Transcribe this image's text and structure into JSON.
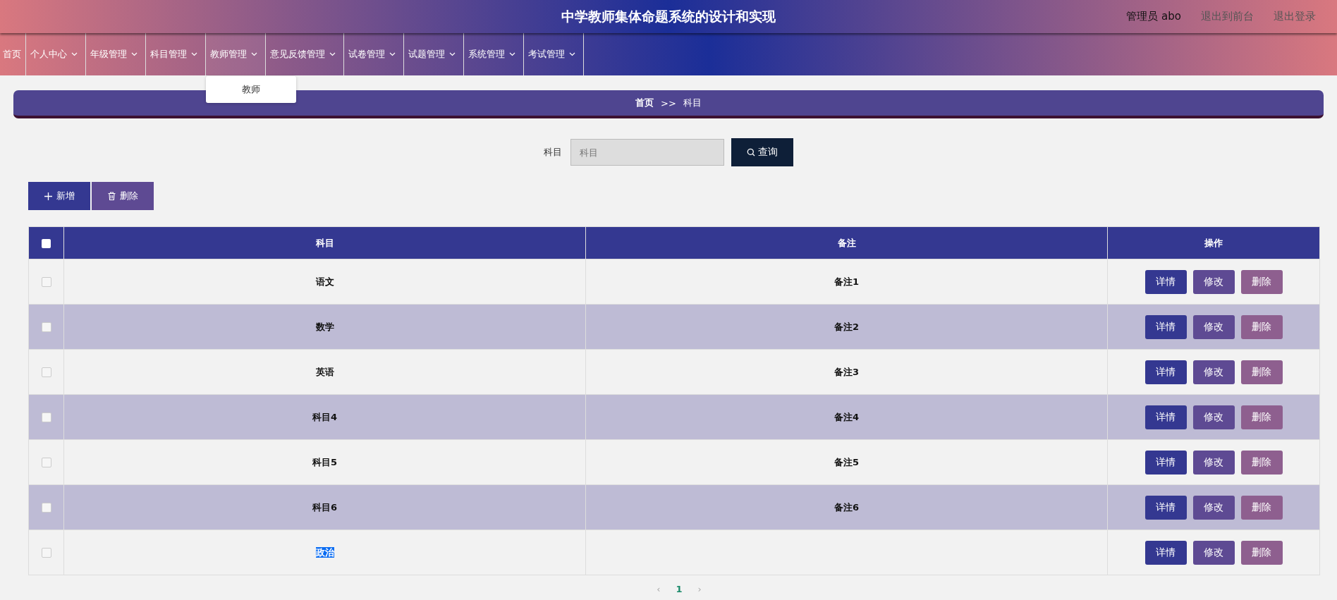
{
  "header": {
    "title": "中学教师集体命题系统的设计和实现",
    "user": "管理员 abo",
    "links": [
      "退出到前台",
      "退出登录"
    ]
  },
  "nav": [
    {
      "label": "首页",
      "has_menu": false,
      "expanded": false
    },
    {
      "label": "个人中心",
      "has_menu": true,
      "expanded": false
    },
    {
      "label": "年级管理",
      "has_menu": true,
      "expanded": false
    },
    {
      "label": "科目管理",
      "has_menu": true,
      "expanded": false
    },
    {
      "label": "教师管理",
      "has_menu": true,
      "expanded": true,
      "children": [
        "教师"
      ]
    },
    {
      "label": "意见反馈管理",
      "has_menu": true,
      "expanded": false
    },
    {
      "label": "试卷管理",
      "has_menu": true,
      "expanded": false
    },
    {
      "label": "试题管理",
      "has_menu": true,
      "expanded": false
    },
    {
      "label": "系统管理",
      "has_menu": true,
      "expanded": false
    },
    {
      "label": "考试管理",
      "has_menu": true,
      "expanded": false
    }
  ],
  "breadcrumb": {
    "home": "首页",
    "separator": ">>",
    "current": "科目"
  },
  "search": {
    "label": "科目",
    "placeholder": "科目",
    "button": "查询"
  },
  "toolbar": [
    {
      "kind": "add",
      "label": "新增"
    },
    {
      "kind": "delete",
      "label": "删除"
    }
  ],
  "table": {
    "columns": [
      "科目",
      "备注",
      "操作"
    ],
    "select_all": false,
    "rows": [
      {
        "subject": "语文",
        "note": "备注1",
        "checked": false,
        "text_selected": false,
        "actions": [
          "详情",
          "修改",
          "删除"
        ]
      },
      {
        "subject": "数学",
        "note": "备注2",
        "checked": false,
        "text_selected": false,
        "actions": [
          "详情",
          "修改",
          "删除"
        ]
      },
      {
        "subject": "英语",
        "note": "备注3",
        "checked": false,
        "text_selected": false,
        "actions": [
          "详情",
          "修改",
          "删除"
        ]
      },
      {
        "subject": "科目4",
        "note": "备注4",
        "checked": false,
        "text_selected": false,
        "actions": [
          "详情",
          "修改",
          "删除"
        ]
      },
      {
        "subject": "科目5",
        "note": "备注5",
        "checked": false,
        "text_selected": false,
        "actions": [
          "详情",
          "修改",
          "删除"
        ]
      },
      {
        "subject": "科目6",
        "note": "备注6",
        "checked": false,
        "text_selected": false,
        "actions": [
          "详情",
          "修改",
          "删除"
        ]
      },
      {
        "subject": "政治",
        "checked": false,
        "text_selected": true,
        "actions": [
          "详情",
          "修改",
          "删除"
        ]
      }
    ]
  },
  "pagination": {
    "prev": "‹",
    "pages": [
      {
        "label": "1",
        "selected": true
      }
    ],
    "next": "›"
  }
}
